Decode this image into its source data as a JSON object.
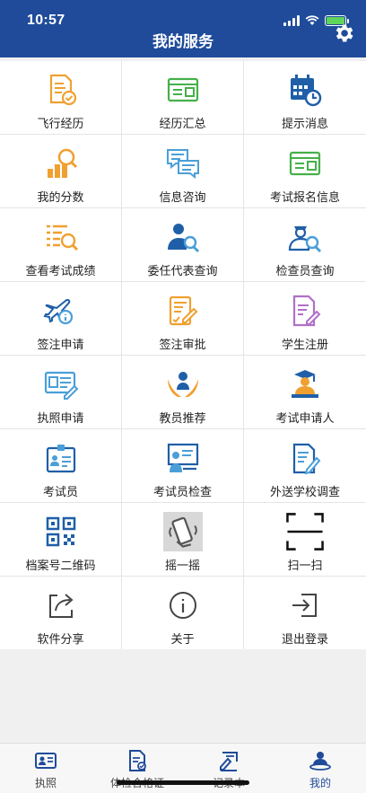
{
  "status": {
    "time": "10:57"
  },
  "header": {
    "title": "我的服务"
  },
  "services": [
    {
      "label": "飞行经历",
      "icon": "logbook-check-icon"
    },
    {
      "label": "经历汇总",
      "icon": "summary-card-icon"
    },
    {
      "label": "提示消息",
      "icon": "calendar-clock-icon"
    },
    {
      "label": "我的分数",
      "icon": "chart-search-icon"
    },
    {
      "label": "信息咨询",
      "icon": "chat-bubbles-icon"
    },
    {
      "label": "考试报名信息",
      "icon": "registration-card-icon"
    },
    {
      "label": "查看考试成绩",
      "icon": "list-search-icon"
    },
    {
      "label": "委任代表查询",
      "icon": "person-search-icon"
    },
    {
      "label": "检查员查询",
      "icon": "inspector-search-icon"
    },
    {
      "label": "签注申请",
      "icon": "airplane-info-icon"
    },
    {
      "label": "签注审批",
      "icon": "approval-stamp-icon"
    },
    {
      "label": "学生注册",
      "icon": "document-edit-icon"
    },
    {
      "label": "执照申请",
      "icon": "license-card-icon"
    },
    {
      "label": "教员推荐",
      "icon": "hands-person-icon"
    },
    {
      "label": "考试申请人",
      "icon": "graduate-icon"
    },
    {
      "label": "考试员",
      "icon": "id-badge-icon"
    },
    {
      "label": "考试员检查",
      "icon": "presentation-board-icon"
    },
    {
      "label": "外送学校调查",
      "icon": "document-pen-icon"
    },
    {
      "label": "档案号二维码",
      "icon": "qr-code-icon"
    },
    {
      "label": "摇一摇",
      "icon": "shake-phone-icon"
    },
    {
      "label": "扫一扫",
      "icon": "scan-frame-icon"
    },
    {
      "label": "软件分享",
      "icon": "share-icon"
    },
    {
      "label": "关于",
      "icon": "info-icon"
    },
    {
      "label": "退出登录",
      "icon": "logout-icon"
    }
  ],
  "tabbar": {
    "items": [
      {
        "label": "执照",
        "icon": "license-tab-icon",
        "active": false
      },
      {
        "label": "体检合格证",
        "icon": "medical-cert-tab-icon",
        "active": false
      },
      {
        "label": "记录本",
        "icon": "logbook-tab-icon",
        "active": false
      },
      {
        "label": "我的",
        "icon": "profile-tab-icon",
        "active": true
      }
    ]
  },
  "colors": {
    "header": "#1f4b9a",
    "orange": "#f0a030",
    "green": "#45b04a",
    "blue": "#1f5fa8",
    "active": "#1f4b9a"
  }
}
